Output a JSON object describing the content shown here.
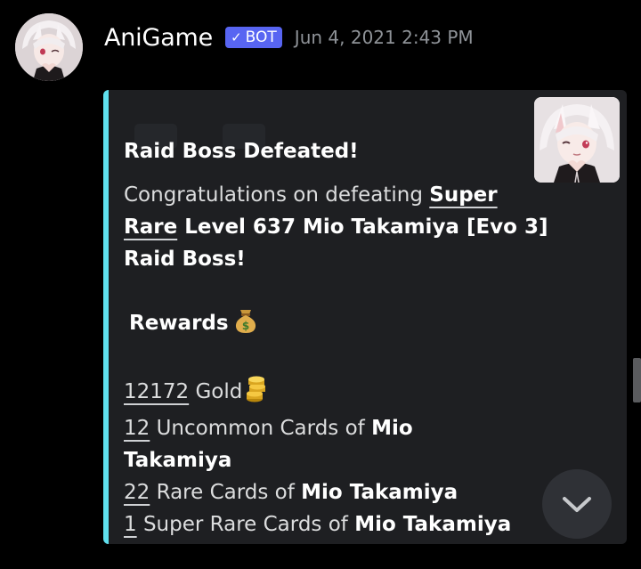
{
  "message": {
    "username": "AniGame",
    "bot_badge": {
      "check": "✓",
      "label": "BOT"
    },
    "timestamp": "Jun 4, 2021 2:43 PM",
    "avatar_icon": "anime-girl-avatar-icon"
  },
  "embed": {
    "accent_color": "#5fe0ee",
    "title": "Raid Boss Defeated!",
    "description": {
      "congrats_prefix": "Congratulations on defeating ",
      "line1_bold": "Super",
      "line2_underlined": "Rare",
      "line2_rest": " Level 637 Mio Takamiya [Evo 3]",
      "line3": "Raid Boss!"
    },
    "rewards_heading": "Rewards",
    "rewards_icon": "money-bag-icon",
    "rewards": [
      {
        "amount": "12172",
        "text": " Gold",
        "icon": "coins-icon"
      },
      {
        "amount": "12",
        "text": " Uncommon Cards of ",
        "bold": "Mio",
        "bold2": "Takamiya"
      },
      {
        "amount": "22",
        "text": " Rare Cards of ",
        "bold": "Mio Takamiya"
      },
      {
        "amount": "1",
        "text": " Super Rare Cards of ",
        "bold": "Mio Takamiya"
      }
    ],
    "thumbnail_icon": "anime-girl-thumbnail-icon"
  },
  "jump_button_icon": "chevron-down-icon"
}
